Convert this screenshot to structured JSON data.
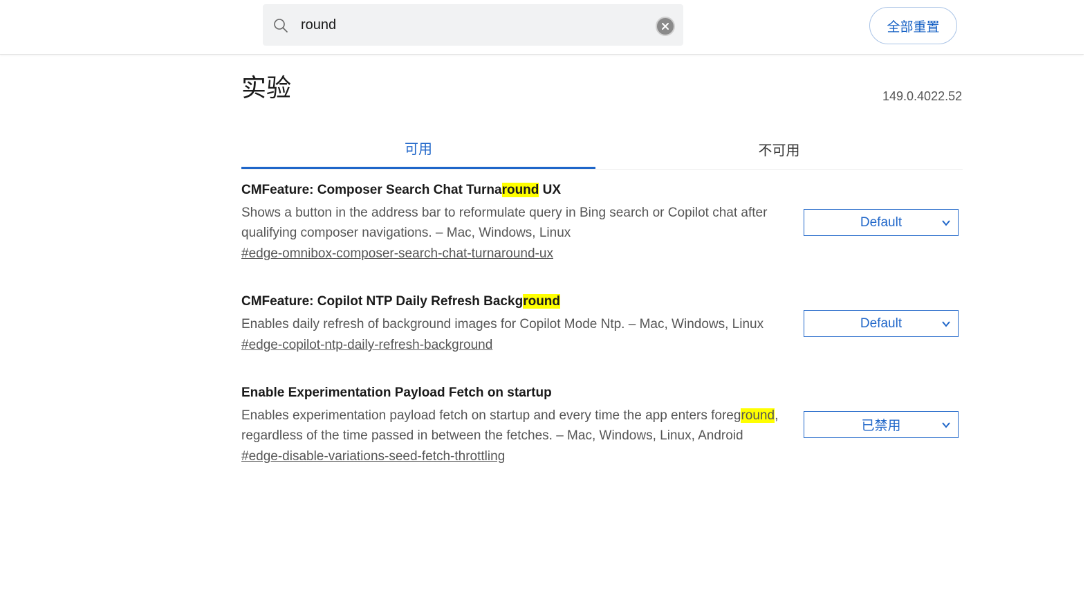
{
  "search": {
    "value": "round",
    "clear_label": "×"
  },
  "header": {
    "reset_all_label": "全部重置"
  },
  "page": {
    "title": "实验",
    "version": "149.0.4022.52"
  },
  "tabs": [
    {
      "label": "可用",
      "active": true
    },
    {
      "label": "不可用",
      "active": false
    }
  ],
  "highlight_color": "#ffff00",
  "accent_color": "#1f66c9",
  "experiments": [
    {
      "title_parts": [
        "CMFeature: Composer Search Chat Turna",
        "round",
        " UX"
      ],
      "description_parts": [
        "Shows a button in the address bar to reformulate query in Bing search or Copilot chat after qualifying composer navigations. – Mac, Windows, Linux"
      ],
      "link": "#edge-omnibox-composer-search-chat-turnaround-ux",
      "selected": "Default"
    },
    {
      "title_parts": [
        "CMFeature: Copilot NTP Daily Refresh Backg",
        "round",
        ""
      ],
      "description_parts": [
        "Enables daily refresh of background images for Copilot Mode Ntp. – Mac, Windows, Linux"
      ],
      "link": "#edge-copilot-ntp-daily-refresh-background",
      "selected": "Default"
    },
    {
      "title_parts": [
        "Enable Experimentation Payload Fetch on startup"
      ],
      "description_parts": [
        "Enables experimentation payload fetch on startup and every time the app enters foreg",
        "round",
        ", regardless of the time passed in between the fetches. – Mac, Windows, Linux, Android"
      ],
      "link": "#edge-disable-variations-seed-fetch-throttling",
      "selected": "已禁用"
    }
  ]
}
